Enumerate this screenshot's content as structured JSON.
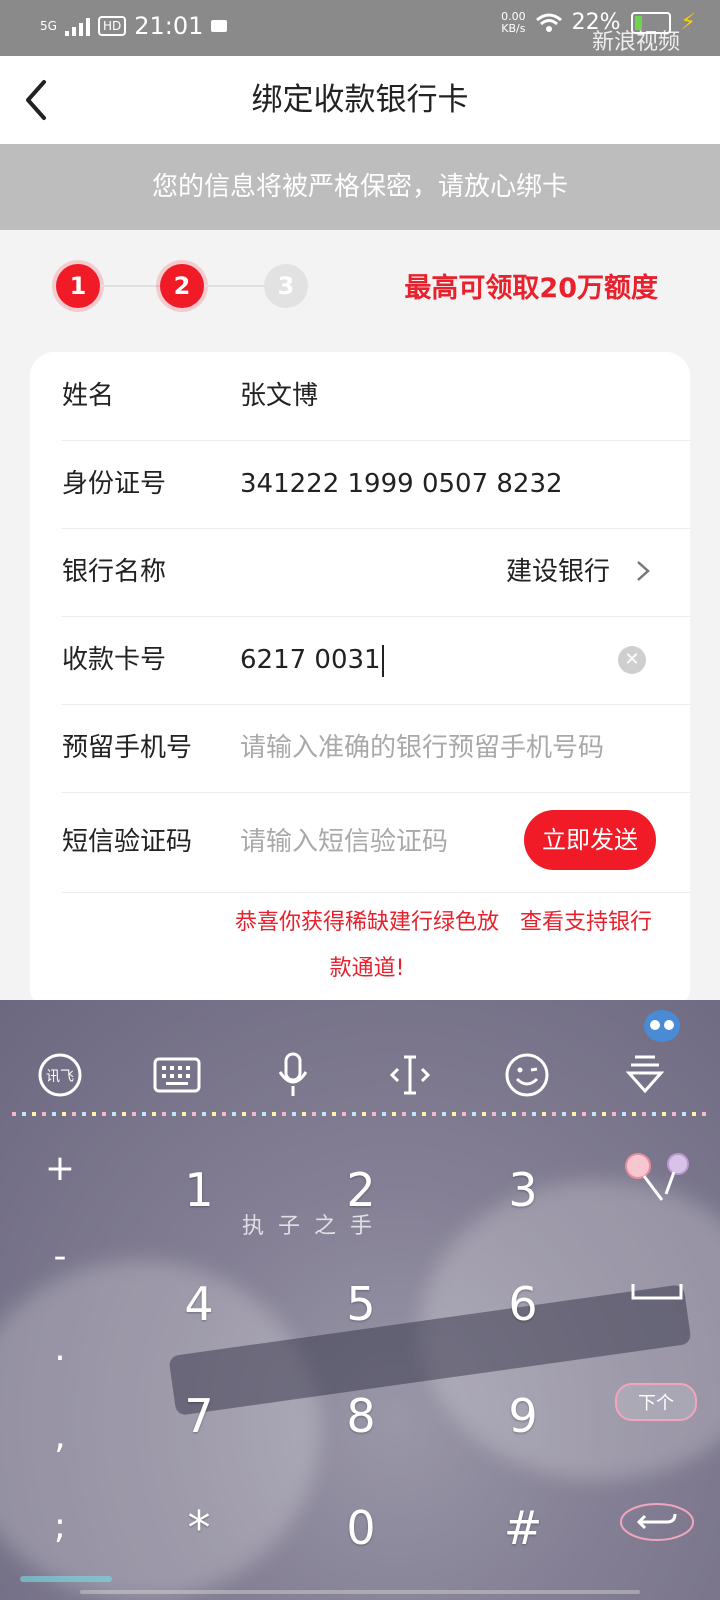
{
  "status_bar": {
    "network": "5G",
    "hd": "HD",
    "time": "21:01",
    "net_speed_value": "0.00",
    "net_speed_unit": "KB/s",
    "battery": "22%",
    "watermark": "新浪视频"
  },
  "header": {
    "title": "绑定收款银行卡"
  },
  "notice": "您的信息将被严格保密，请放心绑卡",
  "steps": {
    "items": [
      "1",
      "2",
      "3"
    ],
    "current": 2,
    "promo": "最高可领取20万额度"
  },
  "form": {
    "name": {
      "label": "姓名",
      "value": "张文博"
    },
    "id_number": {
      "label": "身份证号",
      "value": "341222 1999 0507 8232"
    },
    "bank": {
      "label": "银行名称",
      "value": "建设银行"
    },
    "card_number": {
      "label": "收款卡号",
      "value": "6217 0031"
    },
    "phone": {
      "label": "预留手机号",
      "placeholder": "请输入准确的银行预留手机号码"
    },
    "sms": {
      "label": "短信验证码",
      "placeholder": "请输入短信验证码",
      "button": "立即发送"
    }
  },
  "congrats": "恭喜你获得稀缺建行绿色放款通道!",
  "support_link": "查看支持银行",
  "keyboard": {
    "toolbar_icons": [
      "xunfei-logo-icon",
      "keyboard-icon",
      "microphone-icon",
      "cursor-move-icon",
      "emoji-icon",
      "collapse-keyboard-icon"
    ],
    "xunfei_label": "讯飞",
    "keys": [
      "1",
      "2",
      "3",
      "4",
      "5",
      "6",
      "7",
      "8",
      "9",
      "*",
      "0",
      "#"
    ],
    "side_keys": [
      "+",
      "-",
      ".",
      ",",
      ";"
    ],
    "decoration_text": "执子之手",
    "next_label": "下个",
    "colors": {
      "accent": "#f01b27",
      "keyboard_bg": "#847f94"
    }
  }
}
